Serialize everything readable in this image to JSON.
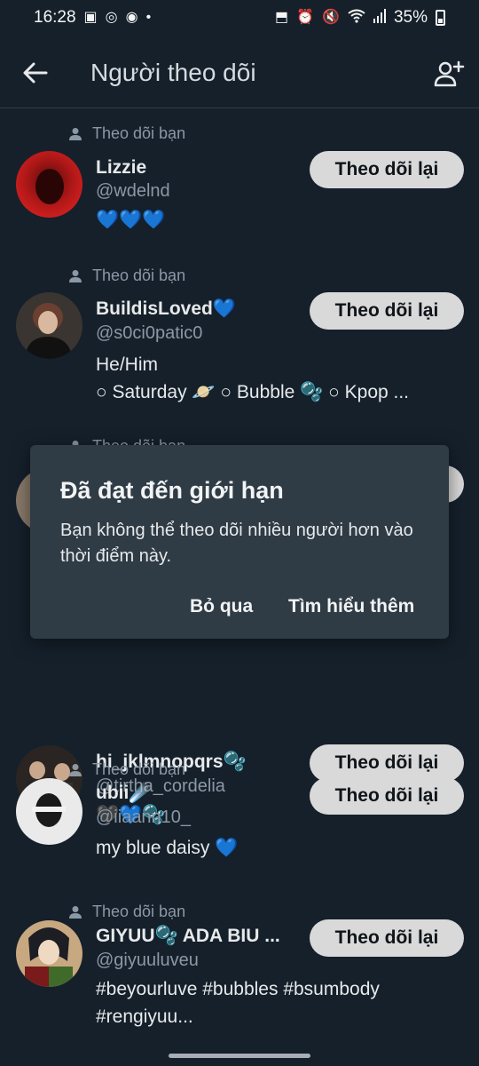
{
  "status_bar": {
    "time": "16:28",
    "battery": "35%"
  },
  "header": {
    "title": "Người theo dõi"
  },
  "follows_you_label": "Theo dõi bạn",
  "follow_back_label": "Theo dõi lại",
  "followers": [
    {
      "name": "Lizzie",
      "handle": "@wdelnd",
      "bio": [
        "💙💙💙"
      ]
    },
    {
      "name": "BuildisLoved💙",
      "handle": "@s0ci0patic0",
      "bio": [
        "He/Him",
        "○ Saturday 🪐 ○ Bubble 🫧 ○ Kpop ..."
      ]
    },
    {
      "name": "hi_jklmnopqrs🫧",
      "handle": "@tirtha_cordelia",
      "bio": [
        "🖤💙🫧"
      ]
    },
    {
      "name": "ubii☄️",
      "handle": "@iiaann10_",
      "bio": [
        "my blue daisy 💙"
      ]
    },
    {
      "name": "GIYUU🫧 ADA BIU ...",
      "handle": "@giyuuluveu",
      "bio": [
        "#beyourluve #bubbles #bsumbody",
        "#rengiyuu..."
      ]
    }
  ],
  "dialog": {
    "title": "Đã đạt đến giới hạn",
    "body": "Bạn không thể theo dõi nhiều người hơn vào thời điểm này.",
    "dismiss": "Bỏ qua",
    "learn_more": "Tìm hiểu thêm"
  }
}
